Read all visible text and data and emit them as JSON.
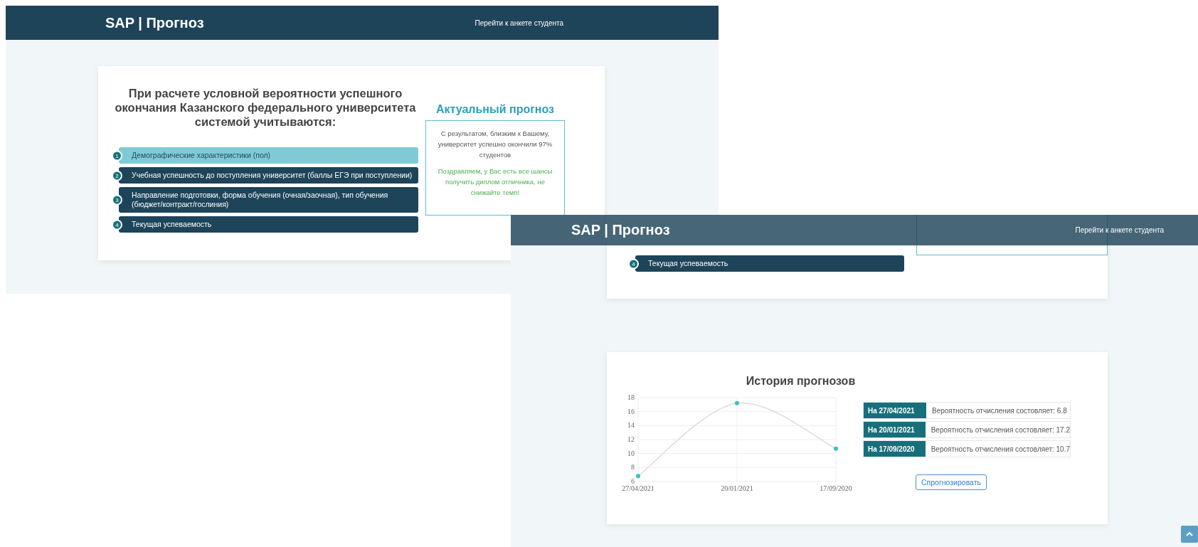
{
  "window_1": {
    "navbar": {
      "brand": "SAP | Прогноз",
      "link": "Перейти к анкете студента"
    },
    "factors": {
      "title": "При расчете условной вероятности успешного окончания Казанского федерального университета системой учитываются:",
      "items": [
        {
          "number": "1",
          "text": "Демографические характеристики (пол)",
          "selected": true
        },
        {
          "number": "2",
          "text": "Учебная успешность до поступления университет (баллы ЕГЭ при поступлении)",
          "selected": false
        },
        {
          "number": "3",
          "text": "Направление подготовки, форма обучения (очная/заочная), тип обучения (бюджет/контракт/гослиния)",
          "selected": false
        },
        {
          "number": "4",
          "text": "Текущая успеваемость",
          "selected": false
        }
      ]
    },
    "forecast": {
      "title": "Актуальный прогноз",
      "result": "С результатом, близким к Вашему, университет успешно окончили 97% студентов",
      "congratulation": "Поздравляем, у Вас есть все шансы получить диплом отличника, не снижайте темп!"
    }
  },
  "window_2": {
    "navbar": {
      "brand": "SAP | Прогноз",
      "link": "Перейти к анкете студента"
    },
    "factors": {
      "items": [
        {
          "number": "4",
          "text": "Текущая успеваемость",
          "selected": false
        }
      ]
    },
    "history": {
      "title": "История прогнозов",
      "chart_data": {
        "type": "line",
        "categories": [
          "27/04/2021",
          "20/01/2021",
          "17/09/2020"
        ],
        "series": [
          {
            "color": "#3bbfc0",
            "marker": true,
            "values": [
              6.8,
              17.2,
              10.7
            ]
          }
        ],
        "ylim": [
          6,
          18
        ],
        "yticks": [
          6,
          8,
          10,
          12,
          14,
          16,
          18
        ],
        "grid": true
      },
      "entries": [
        {
          "date": "На 27/04/2021",
          "text": "Вероятность отчисления состовляет: 6.8"
        },
        {
          "date": "На 20/01/2021",
          "text": "Вероятность отчисления состовляет: 17.2"
        },
        {
          "date": "На 17/09/2020",
          "text": "Вероятность отчисления состовляет: 10.7"
        }
      ],
      "button": "Спрогнозировать"
    }
  }
}
